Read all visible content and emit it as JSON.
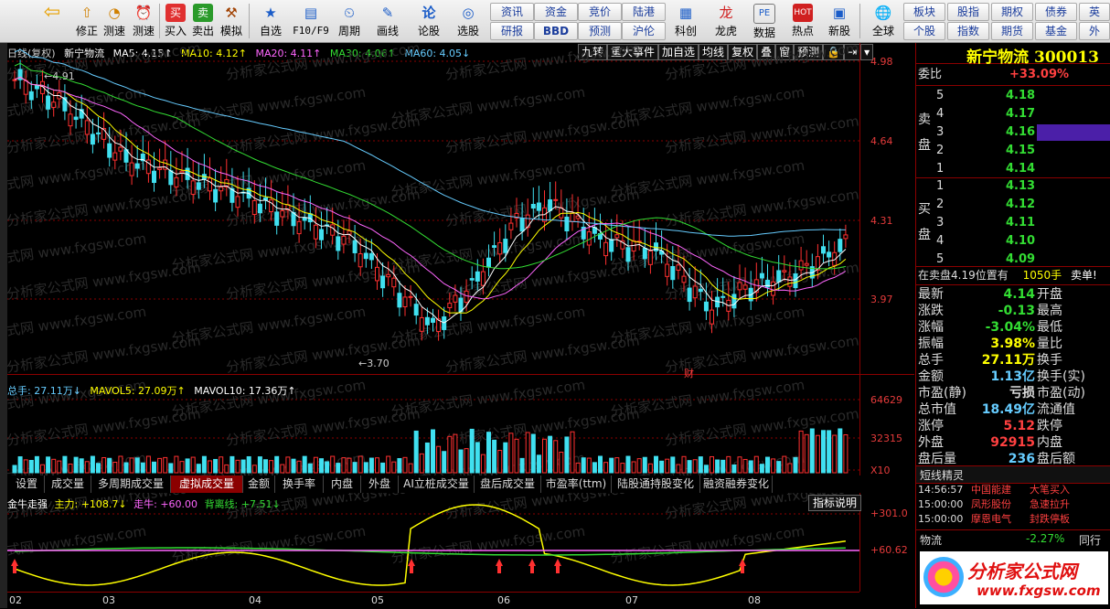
{
  "toolbar": {
    "buttons": [
      {
        "label": "",
        "icon": "back-icon"
      },
      {
        "label": "修正",
        "icon": "up-arrow-icon"
      },
      {
        "label": "测速",
        "icon": "clock-icon"
      },
      {
        "label": "买入",
        "icon": "buy-icon"
      },
      {
        "label": "卖出",
        "icon": "sell-icon"
      },
      {
        "label": "模拟",
        "icon": "hammer-icon"
      },
      {
        "label": "自选",
        "icon": "star-icon"
      },
      {
        "label": "F10/F9",
        "icon": "f10-icon"
      },
      {
        "label": "周期",
        "icon": "period-icon"
      },
      {
        "label": "画线",
        "icon": "pencil-icon"
      },
      {
        "label": "论股",
        "icon": "discuss-icon"
      },
      {
        "label": "选股",
        "icon": "select-stock-icon"
      },
      {
        "label": "科创",
        "icon": "kechuang-icon"
      },
      {
        "label": "龙虎",
        "icon": "dragon-icon"
      },
      {
        "label": "数据",
        "icon": "data-icon"
      },
      {
        "label": "热点",
        "icon": "hot-icon"
      },
      {
        "label": "新股",
        "icon": "newstock-icon"
      },
      {
        "label": "全球",
        "icon": "globe-icon"
      }
    ],
    "small_buttons": [
      "资讯",
      "资金",
      "竞价",
      "陆港",
      "研报",
      "BBD",
      "预测",
      "沪伦",
      "板块",
      "股指",
      "期权",
      "债券",
      "英",
      "个股",
      "指数",
      "期货",
      "基金",
      "外"
    ]
  },
  "chart": {
    "header": "日线(复权)",
    "stock_name": "新宁物流",
    "ma": [
      {
        "label": "MA5: 4.15↑",
        "color": "#ffffff"
      },
      {
        "label": "MA10: 4.12↑",
        "color": "#ffff00"
      },
      {
        "label": "MA20: 4.11↑",
        "color": "#ff66ff"
      },
      {
        "label": "MA30: 4.06↑",
        "color": "#33dd33"
      },
      {
        "label": "MA60: 4.05↓",
        "color": "#66ccff"
      }
    ],
    "right_buttons": [
      "九转",
      "重大事件",
      "加自选",
      "均线",
      "复权",
      "叠",
      "窗",
      "预测"
    ],
    "y_labels": [
      "4.98",
      "4.64",
      "4.31",
      "3.97"
    ],
    "high_label": "4.91",
    "low_label": "3.70",
    "cai_label": "财",
    "vol_legend": [
      {
        "label": "总手: 27.11万↓",
        "color": "#66ccff"
      },
      {
        "label": "MAVOL5: 27.09万↑",
        "color": "#ffff00"
      },
      {
        "label": "MAVOL10: 17.36万↑",
        "color": "#ffffff"
      }
    ],
    "vol_y_labels": [
      "64629",
      "32315",
      "X10"
    ],
    "tabs": [
      "设置",
      "成交量",
      "多周期成交量",
      "虚拟成交量",
      "金额",
      "换手率",
      "内盘",
      "外盘",
      "AI立桩成交量",
      "盘后成交量",
      "市盈率(ttm)",
      "陆股通持股变化",
      "融资融券变化"
    ],
    "active_tab": "虚拟成交量",
    "ind_legend": [
      {
        "label": "金牛走强",
        "color": "#ffffff"
      },
      {
        "label": "主力: +108.7↓",
        "color": "#ffff00"
      },
      {
        "label": "走牛: +60.00",
        "color": "#ff66ff"
      },
      {
        "label": "背离线: +7.51↓",
        "color": "#33dd33"
      }
    ],
    "ind_button": "指标说明",
    "ind_y_labels": [
      "+301.0",
      "+60.62"
    ],
    "x_labels": [
      "02",
      "03",
      "04",
      "05",
      "06",
      "07",
      "08"
    ],
    "watermark": "分析家公式网 www.fxgsw.com"
  },
  "quote": {
    "title": "新宁物流 300013",
    "weibi_label": "委比",
    "weibi": "+33.09%",
    "sell_label": "卖盘",
    "buy_label": "买盘",
    "sell": [
      {
        "lvl": "5",
        "price": "4.18",
        "vol": ""
      },
      {
        "lvl": "4",
        "price": "4.17",
        "vol": ""
      },
      {
        "lvl": "3",
        "price": "4.16",
        "vol": ""
      },
      {
        "lvl": "2",
        "price": "4.15",
        "vol": ""
      },
      {
        "lvl": "1",
        "price": "4.14",
        "vol": ""
      }
    ],
    "buy": [
      {
        "lvl": "1",
        "price": "4.13",
        "vol": ""
      },
      {
        "lvl": "2",
        "price": "4.12",
        "vol": ""
      },
      {
        "lvl": "3",
        "price": "4.11",
        "vol": ""
      },
      {
        "lvl": "4",
        "price": "4.10",
        "vol": ""
      },
      {
        "lvl": "5",
        "price": "4.09",
        "vol": ""
      }
    ],
    "note": "在卖盘4.19位置有",
    "note_vol": "1050手",
    "note_tag": "卖单!",
    "stats": [
      {
        "k": "最新",
        "v": "4.14",
        "k2": "开盘",
        "c": "#33dd33"
      },
      {
        "k": "涨跌",
        "v": "-0.13",
        "k2": "最高",
        "c": "#33dd33"
      },
      {
        "k": "涨幅",
        "v": "-3.04%",
        "k2": "最低",
        "c": "#33dd33"
      },
      {
        "k": "振幅",
        "v": "3.98%",
        "k2": "量比",
        "c": "#ffff00"
      },
      {
        "k": "总手",
        "v": "27.11万",
        "k2": "换手",
        "c": "#ffff00"
      },
      {
        "k": "金额",
        "v": "1.13亿",
        "k2": "换手(实)",
        "c": "#66ccff"
      },
      {
        "k": "市盈(静)",
        "v": "亏损",
        "k2": "市盈(动)",
        "c": "#dddddd"
      },
      {
        "k": "总市值",
        "v": "18.49亿",
        "k2": "流通值",
        "c": "#66ccff"
      },
      {
        "k": "涨停",
        "v": "5.12",
        "k2": "跌停",
        "c": "#ff4040"
      },
      {
        "k": "外盘",
        "v": "92915",
        "k2": "内盘",
        "c": "#ff4040"
      },
      {
        "k": "盘后量",
        "v": "236",
        "k2": "盘后额",
        "c": "#66ccff"
      }
    ],
    "elves_title": "短线精灵",
    "elves": [
      {
        "t": "14:56:57",
        "n": "中国能建",
        "s": "大笔买入"
      },
      {
        "t": "15:00:00",
        "n": "凤形股份",
        "s": "急速拉升"
      },
      {
        "t": "15:00:00",
        "n": "摩恩电气",
        "s": "封跌停板"
      }
    ],
    "sector": "物流",
    "sector_pct": "-2.27%",
    "sector_btn": "同行",
    "logo": "分析家公式网",
    "logo_url": "www.fxgsw.com"
  }
}
